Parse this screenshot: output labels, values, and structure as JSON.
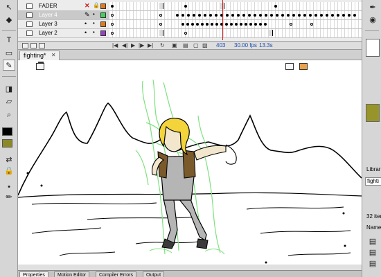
{
  "document": {
    "tab_title": "fighting*"
  },
  "timeline": {
    "layers": [
      {
        "name": "FADER",
        "outline_color": "#e07b1c",
        "visible": "x",
        "selected": false
      },
      {
        "name": "Layer 4",
        "outline_color": "#3cd35a",
        "visible": "pencil",
        "selected": true
      },
      {
        "name": "Layer 3",
        "outline_color": "#e07b1c",
        "visible": "dot",
        "selected": false
      },
      {
        "name": "Layer 2",
        "outline_color": "#9a3fc7",
        "visible": "dot",
        "selected": false
      }
    ],
    "current_frame": "403",
    "frame_rate": "30.00 fps",
    "elapsed_time": "13.3s"
  },
  "colors": {
    "stroke": "#000000",
    "fill": "#8c8a28",
    "right_swatch": "#97952a"
  },
  "right_panel": {
    "library_label": "Librar",
    "library_field": "fighti",
    "items_label": "32 item",
    "name_header": "Name"
  },
  "bottom_tabs": [
    "Properties",
    "Motion Editor",
    "Compiler Errors",
    "Output"
  ]
}
